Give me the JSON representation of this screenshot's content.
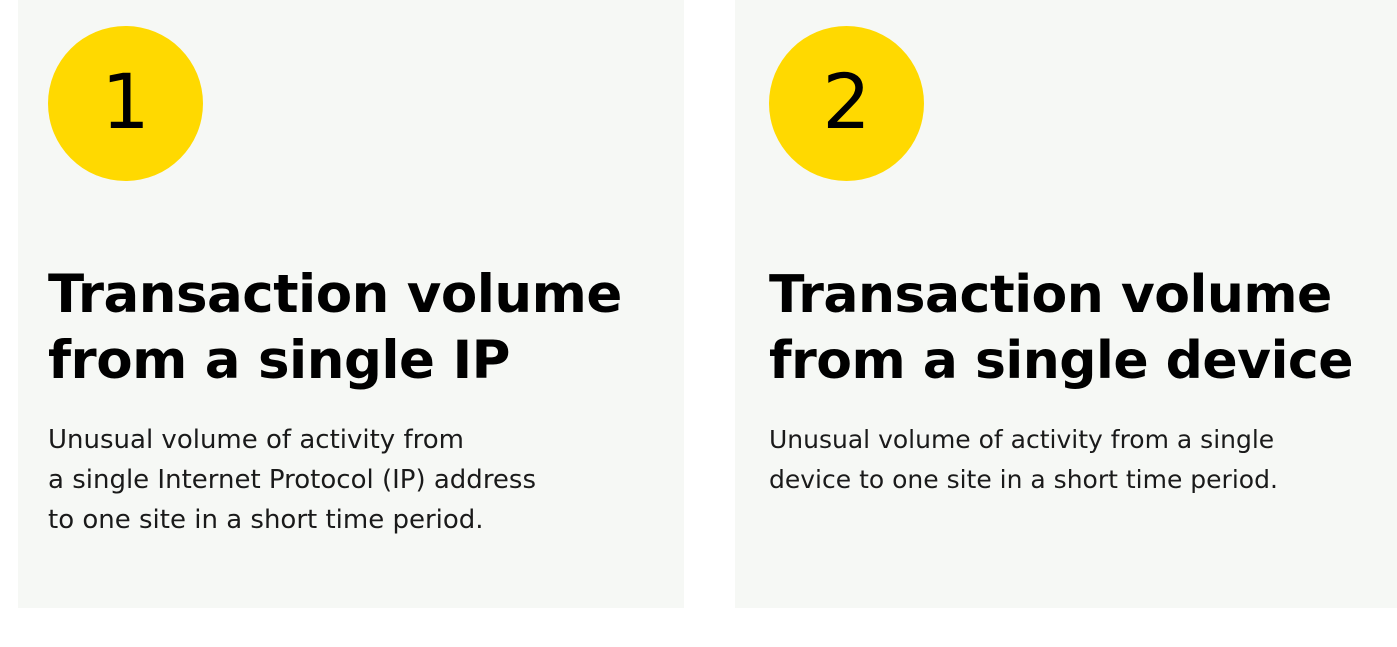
{
  "colors": {
    "card_background": "#f6f8f5",
    "badge_fill": "#ffd900",
    "text": "#000000"
  },
  "cards": [
    {
      "number": "1",
      "title": "Transaction volume\nfrom a single IP",
      "description": "Unusual volume of activity from\na single Internet Protocol (IP) address\nto one site in a short time period."
    },
    {
      "number": "2",
      "title": "Transaction volume\nfrom a single device",
      "description": "Unusual volume of activity from a single\ndevice to one site in a short time period."
    }
  ]
}
